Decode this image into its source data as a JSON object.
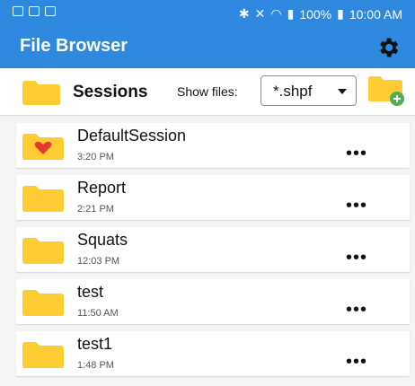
{
  "status_bar": {
    "battery": "100%",
    "time": "10:00 AM"
  },
  "app_bar": {
    "title": "File Browser",
    "settings_icon": "gear-icon"
  },
  "folder_bar": {
    "current_folder": "Sessions",
    "show_files_label": "Show files:",
    "filter_value": "*.shpf",
    "add_folder_icon": "folder-add-icon"
  },
  "files": [
    {
      "name": "DefaultSession",
      "time": "3:20 PM",
      "icon": "folder-heart-icon",
      "more": "•••"
    },
    {
      "name": "Report",
      "time": "2:21 PM",
      "icon": "folder-icon",
      "more": "•••"
    },
    {
      "name": "Squats",
      "time": "12:03 PM",
      "icon": "folder-icon",
      "more": "•••"
    },
    {
      "name": "test",
      "time": "11:50 AM",
      "icon": "folder-icon",
      "more": "•••"
    },
    {
      "name": "test1",
      "time": "1:48 PM",
      "icon": "folder-icon",
      "more": "•••"
    }
  ],
  "colors": {
    "primary": "#2e88de",
    "folder": "#ffcc33",
    "favorite": "#e53935",
    "add": "#4caf50"
  }
}
